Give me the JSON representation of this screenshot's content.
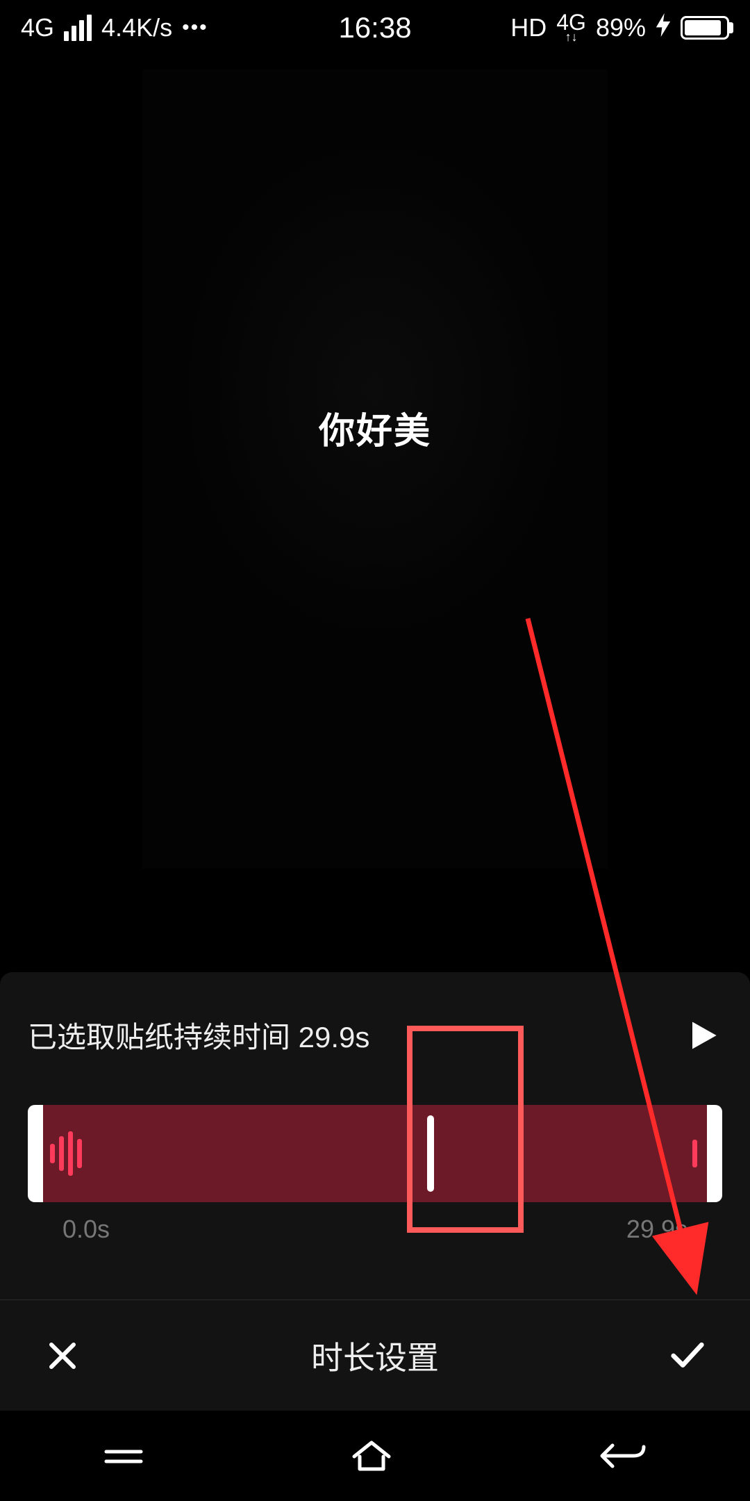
{
  "status": {
    "network_type": "4G",
    "speed": "4.4K/s",
    "time": "16:38",
    "hd": "HD",
    "net_top": "4G",
    "battery_pct": "89%",
    "battery_fill_pct": 89
  },
  "preview": {
    "sticker_text": "你好美"
  },
  "panel": {
    "duration_label": "已选取贴纸持续时间 29.9s",
    "start_time": "0.0s",
    "end_time": "29.9s",
    "playhead_percent": 58,
    "footer_title": "时长设置"
  }
}
